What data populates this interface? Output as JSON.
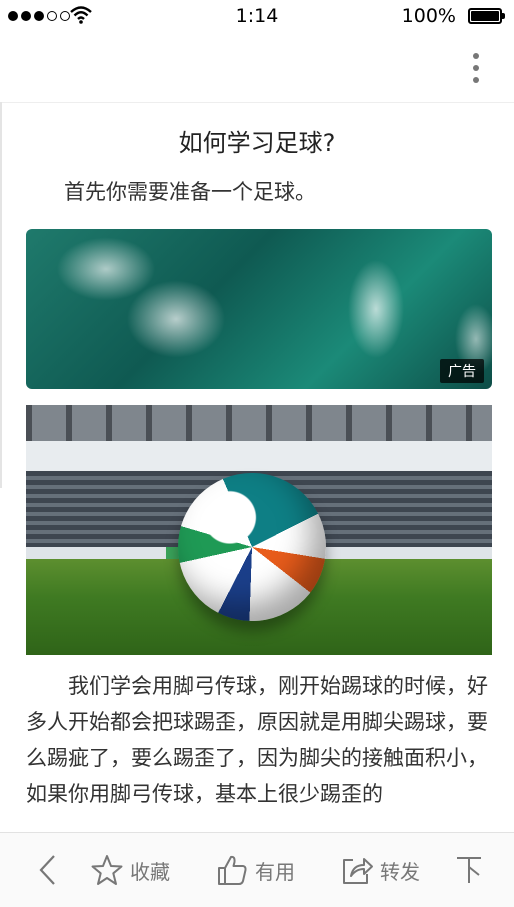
{
  "status_bar": {
    "time": "1:14",
    "battery_percent": "100%",
    "battery_level": 1.0,
    "signal_bars_filled": 3,
    "signal_bars_total": 5
  },
  "article": {
    "title": "如何学习足球?",
    "intro": "首先你需要准备一个足球。",
    "ad_label": "广告",
    "body": "我们学会用脚弓传球，刚开始踢球的时候，好多人开始都会把球踢歪，原因就是用脚尖踢球，要么踢疵了，要么踢歪了，因为脚尖的接触面积小，如果你用脚弓传球，基本上很少踢歪的"
  },
  "toolbar": {
    "back_icon": "chevron-left-icon",
    "favorite_label": "收藏",
    "favorite_icon": "star-icon",
    "useful_label": "有用",
    "useful_icon": "thumbs-up-icon",
    "share_label": "转发",
    "share_icon": "share-icon",
    "next_icon": "down-icon"
  },
  "colors": {
    "icon_gray": "#777777",
    "toolbar_bg": "#fafafa"
  }
}
